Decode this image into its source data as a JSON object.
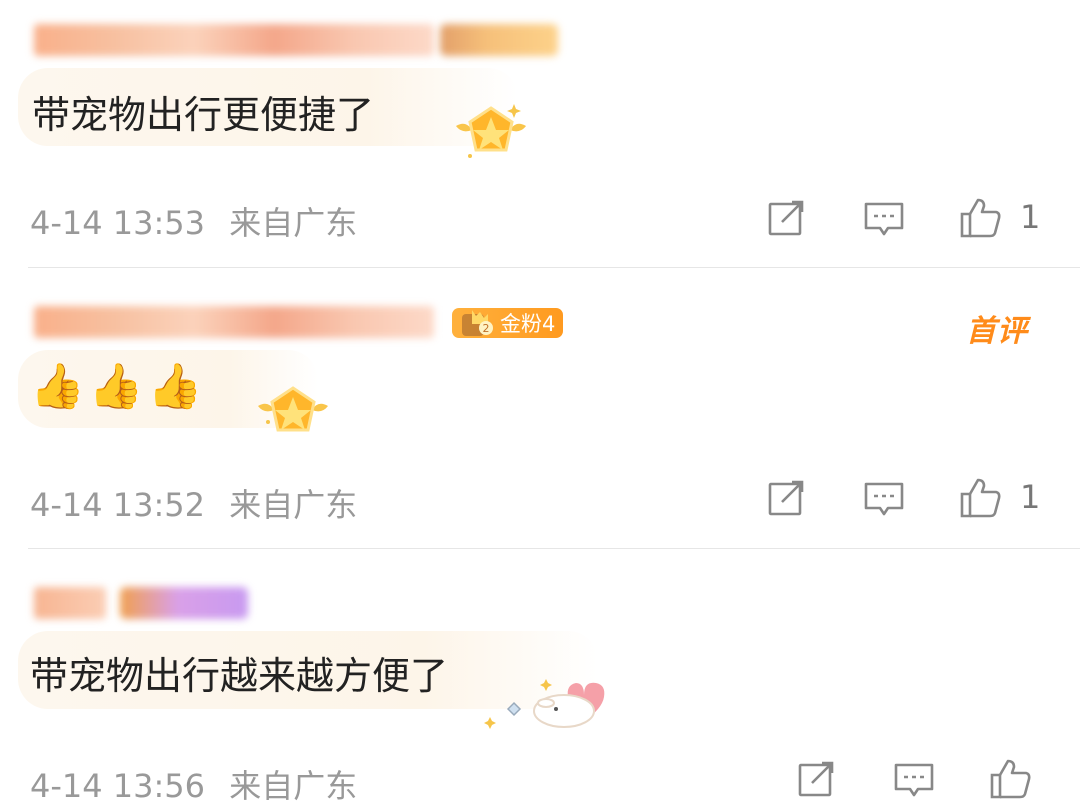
{
  "comments": [
    {
      "text": "带宠物出行更便捷了",
      "time": "4-14 13:53",
      "location": "来自广东",
      "likes": "1"
    },
    {
      "fan_badge": "金粉4",
      "tag": "首评",
      "text": "👍👍👍",
      "time": "4-14 13:52",
      "location": "来自广东",
      "likes": "1"
    },
    {
      "text": "带宠物出行越来越方便了",
      "time": "4-14 13:56",
      "location": "来自广东"
    }
  ],
  "icons": [
    "share-edit-icon",
    "comment-icon",
    "thumbs-up-icon",
    "star-shield-icon",
    "rabbit-heart-sticker"
  ],
  "colors": {
    "accent": "#ff8b1a",
    "meta": "#999999",
    "bubble": "#fdf6ec"
  }
}
